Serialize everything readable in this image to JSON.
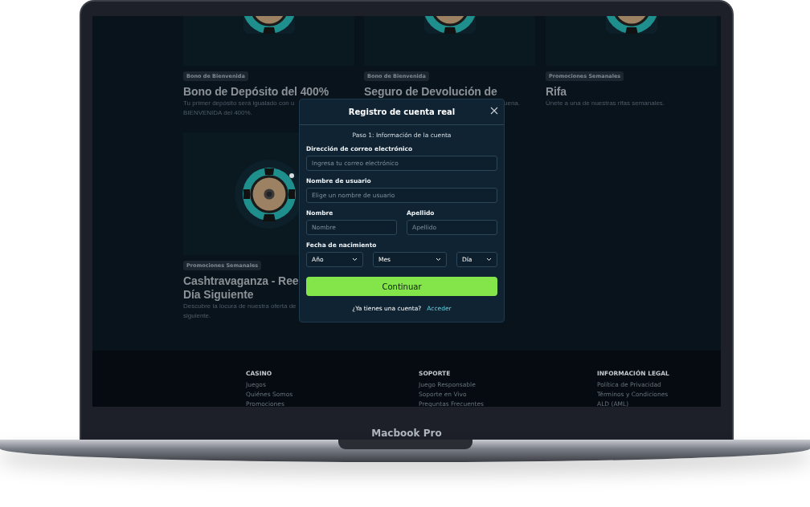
{
  "cards": [
    {
      "badge": "Bono de Bienvenida",
      "title_lines": [
        "Bono de Depósito del 400%"
      ],
      "description_lines": [
        "Tu primer depósito será igualado con u",
        "BIENVENIDA del 400%."
      ]
    },
    {
      "badge": "Bono de Bienvenida",
      "title_lines": [
        "Seguro de Devolución de"
      ],
      "description_lines": [
        "uena."
      ]
    },
    {
      "badge": "Promociones Semanales",
      "title_lines": [
        "Rifa"
      ],
      "description_lines": [
        "Únete a una de nuestras rifas semanales."
      ]
    },
    {
      "badge": "Promociones Semanales",
      "title_lines": [
        "Cashtravaganza - Ree",
        "Día Siguiente"
      ],
      "description_lines": [
        "Descubre la locura de nuestra oferta de",
        "siguiente."
      ]
    }
  ],
  "modal": {
    "title": "Registro de cuenta real",
    "step": "Paso 1: Información de la cuenta",
    "email": {
      "label": "Dirección de correo electrónico",
      "placeholder": "Ingresa tu correo electrónico"
    },
    "username": {
      "label": "Nombre de usuario",
      "placeholder": "Elige un nombre de usuario"
    },
    "first_name": {
      "label": "Nombre",
      "placeholder": "Nombre"
    },
    "last_name": {
      "label": "Apellido",
      "placeholder": "Apellido"
    },
    "birth_date": {
      "label": "Fecha de nacimiento",
      "selects": [
        "Año",
        "Mes",
        "Día"
      ]
    },
    "submit": "Continuar",
    "login_prompt": "¿Ya tienes una cuenta?",
    "login_link": "Acceder"
  },
  "footer": {
    "columns": [
      {
        "heading": "CASINO",
        "links": [
          "Juegos",
          "Quiénes Somos",
          "Promociones"
        ]
      },
      {
        "heading": "SOPORTE",
        "links": [
          "Juego Responsable",
          "Soporte en Vivo",
          "Preguntas Frecuentes"
        ]
      },
      {
        "heading": "INFORMACIÓN LEGAL",
        "links": [
          "Política de Privacidad",
          "Términos y Condiciones",
          "ALD (AML)"
        ]
      }
    ]
  },
  "device_label": "Macbook Pro"
}
